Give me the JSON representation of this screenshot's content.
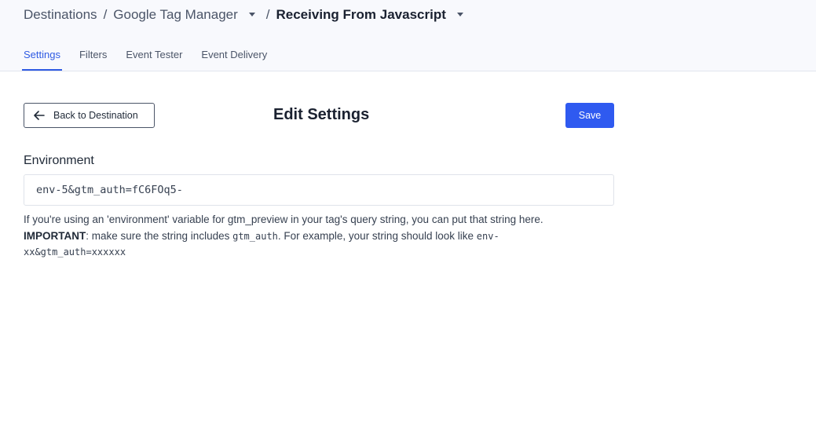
{
  "breadcrumb": {
    "root": "Destinations",
    "separator": "/",
    "destination": "Google Tag Manager",
    "current": "Receiving From Javascript"
  },
  "tabs": [
    {
      "label": "Settings",
      "active": true
    },
    {
      "label": "Filters",
      "active": false
    },
    {
      "label": "Event Tester",
      "active": false
    },
    {
      "label": "Event Delivery",
      "active": false
    }
  ],
  "toolbar": {
    "back_label": "Back to Destination",
    "title": "Edit Settings",
    "save_label": "Save"
  },
  "environment": {
    "label": "Environment",
    "value": "env-5&gtm_auth=fC6FOq5-",
    "help_line1": "If you're using an 'environment' variable for gtm_preview in your tag's query string, you can put that string here.",
    "help_important": "IMPORTANT",
    "help_line2a": ": make sure the string includes ",
    "help_code1": "gtm_auth",
    "help_line2b": ". For example, your string should look like ",
    "help_code2": "env-xx&gtm_auth=xxxxxx"
  },
  "colors": {
    "accent": "#2f5be3",
    "save_button": "#2f5af0",
    "header_bg": "#f8f9fd"
  },
  "icons": {
    "back": "arrow-left-icon",
    "dropdown": "caret-down-icon"
  }
}
